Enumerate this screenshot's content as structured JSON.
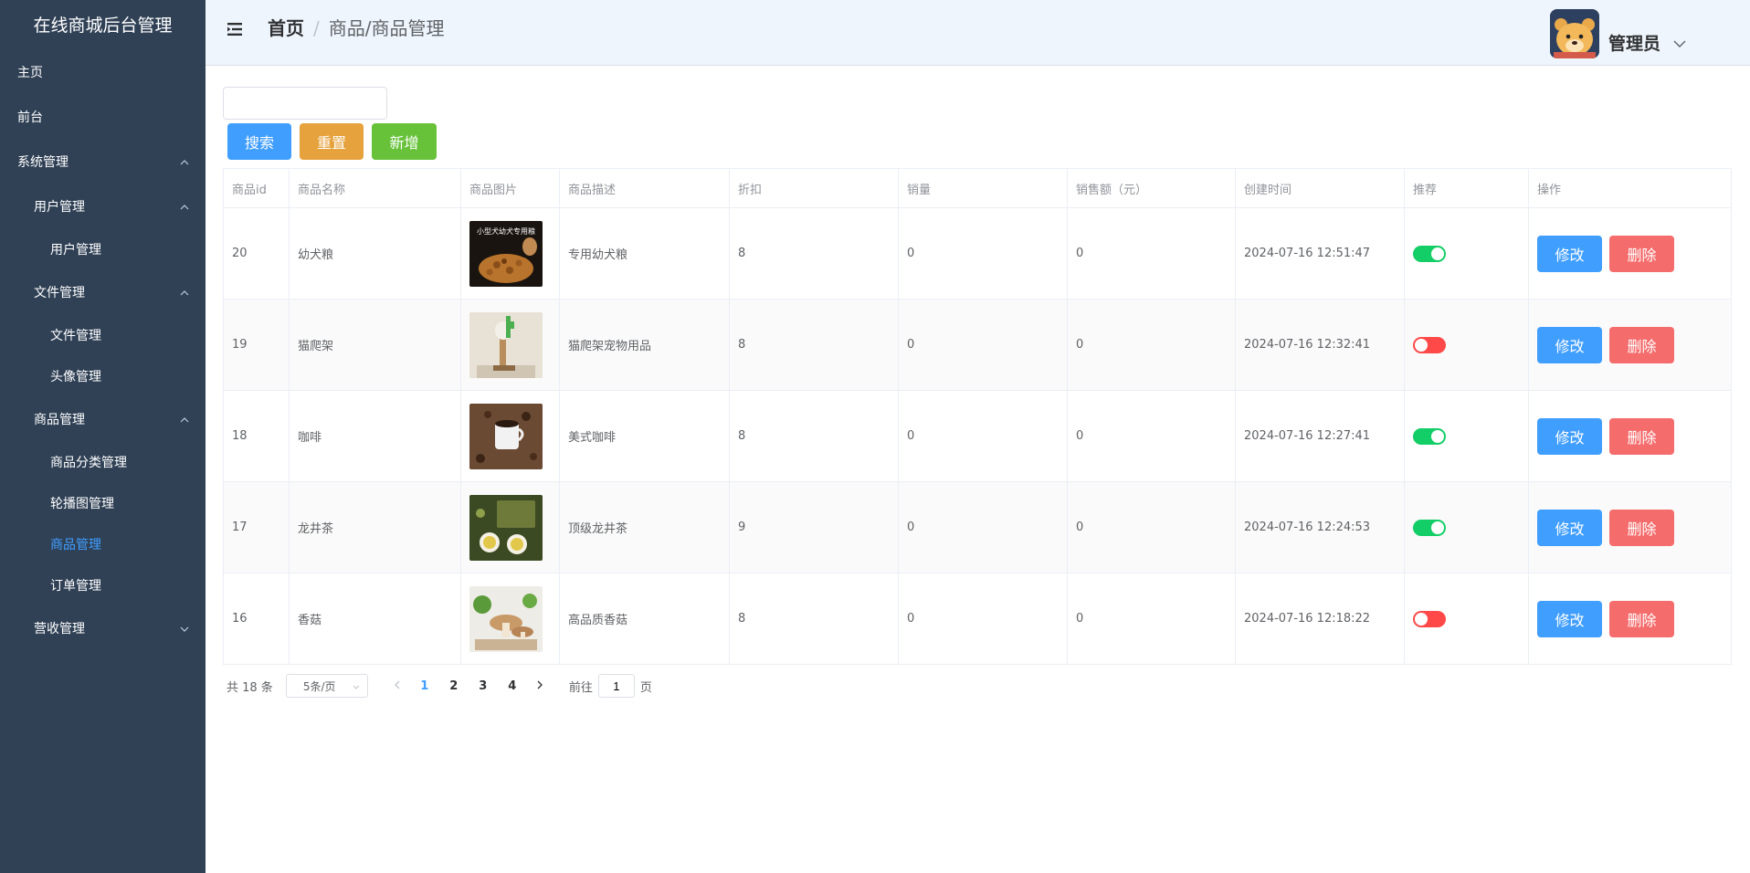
{
  "sidebar": {
    "title": "在线商城后台管理",
    "menu": {
      "home": "主页",
      "front": "前台",
      "system": "系统管理",
      "user_group": "用户管理",
      "user_manage": "用户管理",
      "file_group": "文件管理",
      "file_manage": "文件管理",
      "avatar_manage": "头像管理",
      "goods_group": "商品管理",
      "category_manage": "商品分类管理",
      "carousel_manage": "轮播图管理",
      "goods_manage": "商品管理",
      "order_manage": "订单管理",
      "revenue": "营收管理"
    }
  },
  "header": {
    "breadcrumb_home": "首页",
    "breadcrumb_sep": "/",
    "breadcrumb_current": "商品/商品管理",
    "user_name": "管理员",
    "icons": {
      "menu": "menu-fold-icon",
      "caret": "chevron-down-icon"
    }
  },
  "toolbar": {
    "search_value": "",
    "search_label": "搜索",
    "reset_label": "重置",
    "add_label": "新增"
  },
  "table": {
    "columns": [
      "商品id",
      "商品名称",
      "商品图片",
      "商品描述",
      "折扣",
      "销量",
      "销售额（元）",
      "创建时间",
      "推荐",
      "操作"
    ],
    "rows": [
      {
        "id": "20",
        "name": "幼犬粮",
        "image": "puppy-food-thumbnail",
        "image_caption": "小型犬幼犬专用粮",
        "desc": "专用幼犬粮",
        "discount": "8",
        "sales": "0",
        "amount": "0",
        "created": "2024-07-16  12:51:47",
        "recommend": true,
        "edit": "修改",
        "delete": "删除"
      },
      {
        "id": "19",
        "name": "猫爬架",
        "image": "cat-tree-thumbnail",
        "desc": "猫爬架宠物用品",
        "discount": "8",
        "sales": "0",
        "amount": "0",
        "created": "2024-07-16  12:32:41",
        "recommend": false,
        "edit": "修改",
        "delete": "删除"
      },
      {
        "id": "18",
        "name": "咖啡",
        "image": "coffee-thumbnail",
        "desc": "美式咖啡",
        "discount": "8",
        "sales": "0",
        "amount": "0",
        "created": "2024-07-16  12:27:41",
        "recommend": true,
        "edit": "修改",
        "delete": "删除"
      },
      {
        "id": "17",
        "name": "龙井茶",
        "image": "tea-thumbnail",
        "desc": "顶级龙井茶",
        "discount": "9",
        "sales": "0",
        "amount": "0",
        "created": "2024-07-16  12:24:53",
        "recommend": true,
        "edit": "修改",
        "delete": "删除"
      },
      {
        "id": "16",
        "name": "香菇",
        "image": "mushroom-thumbnail",
        "desc": "高品质香菇",
        "discount": "8",
        "sales": "0",
        "amount": "0",
        "created": "2024-07-16  12:18:22",
        "recommend": false,
        "edit": "修改",
        "delete": "删除"
      }
    ]
  },
  "pagination": {
    "total": "共 18 条",
    "page_size": "5条/页",
    "pages": [
      "1",
      "2",
      "3",
      "4"
    ],
    "current_page": "1",
    "goto_label": "前往",
    "goto_value": "1",
    "page_suffix": "页"
  },
  "colors": {
    "sidebar_bg": "#304156",
    "header_bg": "#eef5fc",
    "primary": "#409eff",
    "warning": "#e6a23c",
    "success": "#67c23a",
    "danger": "#f56c6c",
    "switch_on": "#13ce66",
    "switch_off": "#ff4949"
  }
}
